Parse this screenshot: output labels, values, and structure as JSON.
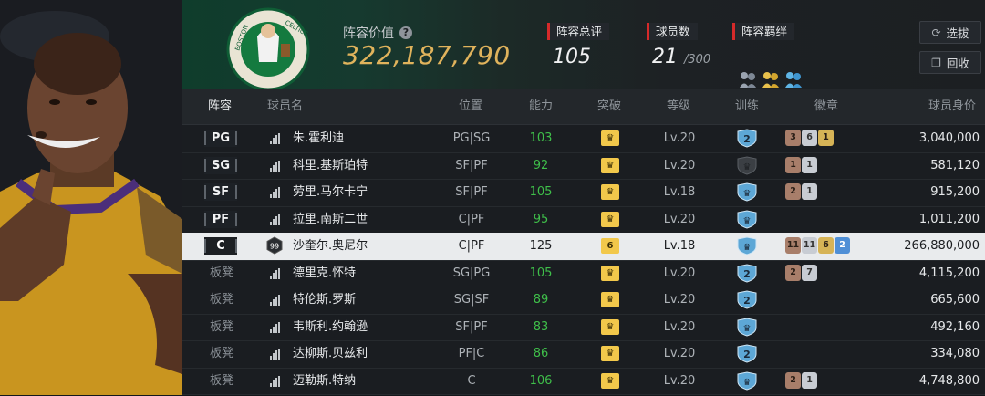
{
  "header": {
    "value_label": "阵容价值",
    "value": "322,187,790",
    "rating_label": "阵容总评",
    "rating": "105",
    "count_label": "球员数",
    "count": "21",
    "count_max": "/300",
    "bond_label": "阵容羁绊",
    "select_button": "选拔",
    "recycle_button": "回收",
    "team_logo": "boston-celtics-logo",
    "accent_color": "#e0b35c",
    "tag_color": "#d62a2a"
  },
  "columns": [
    "阵容",
    "球员名",
    "位置",
    "能力",
    "突破",
    "等级",
    "训练",
    "徽章",
    "球员身价"
  ],
  "rows": [
    {
      "slot": "PG",
      "name": "朱.霍利迪",
      "pos": "PG|SG",
      "ability": "103",
      "breakthrough": "crown",
      "level": "Lv.20",
      "training": "2",
      "badges": [
        {
          "v": "3",
          "c": "br"
        },
        {
          "v": "6",
          "c": "si"
        },
        {
          "v": "1",
          "c": "go"
        }
      ],
      "price": "3,040,000",
      "bench": false
    },
    {
      "slot": "SG",
      "name": "科里.基斯珀特",
      "pos": "SF|PF",
      "ability": "92",
      "breakthrough": "crown",
      "level": "Lv.20",
      "training": "dark",
      "badges": [
        {
          "v": "1",
          "c": "br"
        },
        {
          "v": "1",
          "c": "si"
        }
      ],
      "price": "581,120",
      "bench": false
    },
    {
      "slot": "SF",
      "name": "劳里.马尔卡宁",
      "pos": "SF|PF",
      "ability": "105",
      "breakthrough": "crown",
      "level": "Lv.18",
      "training": "crown",
      "badges": [
        {
          "v": "2",
          "c": "br"
        },
        {
          "v": "1",
          "c": "si"
        }
      ],
      "price": "915,200",
      "bench": false
    },
    {
      "slot": "PF",
      "name": "拉里.南斯二世",
      "pos": "C|PF",
      "ability": "95",
      "breakthrough": "crown",
      "level": "Lv.20",
      "training": "crown",
      "badges": [],
      "price": "1,011,200",
      "bench": false
    },
    {
      "slot": "C",
      "name": "沙奎尔.奥尼尔",
      "pos": "C|PF",
      "ability": "125",
      "breakthrough": "6",
      "level": "Lv.18",
      "training": "crown",
      "badges": [
        {
          "v": "11",
          "c": "br"
        },
        {
          "v": "11",
          "c": "si"
        },
        {
          "v": "6",
          "c": "go"
        },
        {
          "v": "2",
          "c": "bl"
        }
      ],
      "price": "266,880,000",
      "bench": false,
      "selected": true,
      "rank": "99"
    },
    {
      "slot": "板凳",
      "name": "德里克.怀特",
      "pos": "SG|PG",
      "ability": "105",
      "breakthrough": "crown",
      "level": "Lv.20",
      "training": "2",
      "badges": [
        {
          "v": "2",
          "c": "br"
        },
        {
          "v": "7",
          "c": "si"
        }
      ],
      "price": "4,115,200",
      "bench": true
    },
    {
      "slot": "板凳",
      "name": "特伦斯.罗斯",
      "pos": "SG|SF",
      "ability": "89",
      "breakthrough": "crown",
      "level": "Lv.20",
      "training": "2",
      "badges": [],
      "price": "665,600",
      "bench": true
    },
    {
      "slot": "板凳",
      "name": "韦斯利.约翰逊",
      "pos": "SF|PF",
      "ability": "83",
      "breakthrough": "crown",
      "level": "Lv.20",
      "training": "crown",
      "badges": [],
      "price": "492,160",
      "bench": true
    },
    {
      "slot": "板凳",
      "name": "达柳斯.贝兹利",
      "pos": "PF|C",
      "ability": "86",
      "breakthrough": "crown",
      "level": "Lv.20",
      "training": "2",
      "badges": [],
      "price": "334,080",
      "bench": true
    },
    {
      "slot": "板凳",
      "name": "迈勒斯.特纳",
      "pos": "C",
      "ability": "106",
      "breakthrough": "crown",
      "level": "Lv.20",
      "training": "crown",
      "badges": [
        {
          "v": "2",
          "c": "br"
        },
        {
          "v": "1",
          "c": "si"
        }
      ],
      "price": "4,748,800",
      "bench": true
    }
  ]
}
